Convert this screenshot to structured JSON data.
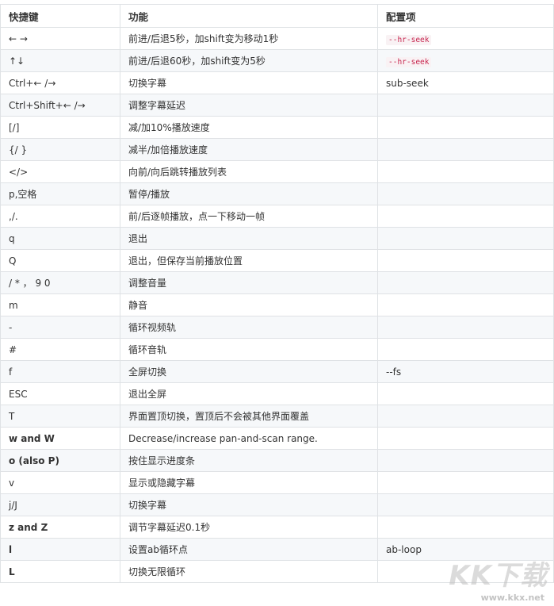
{
  "table": {
    "headers": [
      "快捷键",
      "功能",
      "配置项"
    ],
    "rows": [
      {
        "key": "← →",
        "func": "前进/后退5秒，加shift变为移动1秒",
        "cfg": "--hr-seek",
        "cfg_code": true,
        "bold": false
      },
      {
        "key": "↑↓",
        "func": "前进/后退60秒，加shift变为5秒",
        "cfg": "--hr-seek",
        "cfg_code": true,
        "bold": false
      },
      {
        "key": "Ctrl+← /→",
        "func": "切换字幕",
        "cfg": "sub-seek",
        "cfg_code": false,
        "bold": false
      },
      {
        "key": "Ctrl+Shift+← /→",
        "func": "调整字幕延迟",
        "cfg": "",
        "cfg_code": false,
        "bold": false
      },
      {
        "key": "[/]",
        "func": "减/加10%播放速度",
        "cfg": "",
        "cfg_code": false,
        "bold": false
      },
      {
        "key": "{/ }",
        "func": "减半/加倍播放速度",
        "cfg": "",
        "cfg_code": false,
        "bold": false
      },
      {
        "key": "</>",
        "func": "向前/向后跳转播放列表",
        "cfg": "",
        "cfg_code": false,
        "bold": false
      },
      {
        "key": "p,空格",
        "func": "暂停/播放",
        "cfg": "",
        "cfg_code": false,
        "bold": false
      },
      {
        "key": ",/.",
        "func": "前/后逐帧播放，点一下移动一帧",
        "cfg": "",
        "cfg_code": false,
        "bold": false
      },
      {
        "key": "q",
        "func": "退出",
        "cfg": "",
        "cfg_code": false,
        "bold": false
      },
      {
        "key": "Q",
        "func": "退出，但保存当前播放位置",
        "cfg": "",
        "cfg_code": false,
        "bold": false
      },
      {
        "key": "/ * ， 9 0",
        "func": "调整音量",
        "cfg": "",
        "cfg_code": false,
        "bold": false
      },
      {
        "key": "m",
        "func": "静音",
        "cfg": "",
        "cfg_code": false,
        "bold": false
      },
      {
        "key": "-",
        "func": "循环视频轨",
        "cfg": "",
        "cfg_code": false,
        "bold": false
      },
      {
        "key": "#",
        "func": "循环音轨",
        "cfg": "",
        "cfg_code": false,
        "bold": false
      },
      {
        "key": "f",
        "func": "全屏切换",
        "cfg": "--fs",
        "cfg_code": false,
        "bold": false
      },
      {
        "key": "ESC",
        "func": "退出全屏",
        "cfg": "",
        "cfg_code": false,
        "bold": false
      },
      {
        "key": "T",
        "func": "界面置顶切换，置顶后不会被其他界面覆盖",
        "cfg": "",
        "cfg_code": false,
        "bold": false
      },
      {
        "key": "w and W",
        "func": "Decrease/increase pan-and-scan range.",
        "cfg": "",
        "cfg_code": false,
        "bold": true
      },
      {
        "key": "o (also P)",
        "func": "按住显示进度条",
        "cfg": "",
        "cfg_code": false,
        "bold": true
      },
      {
        "key": "v",
        "func": "显示或隐藏字幕",
        "cfg": "",
        "cfg_code": false,
        "bold": false
      },
      {
        "key": "j/J",
        "func": "切换字幕",
        "cfg": "",
        "cfg_code": false,
        "bold": false
      },
      {
        "key": "z and Z",
        "func": "调节字幕延迟0.1秒",
        "cfg": "",
        "cfg_code": false,
        "bold": true
      },
      {
        "key": "l",
        "func": "设置ab循环点",
        "cfg": "ab-loop",
        "cfg_code": false,
        "bold": true
      },
      {
        "key": "L",
        "func": "切换无限循环",
        "cfg": "",
        "cfg_code": false,
        "bold": true
      }
    ]
  },
  "watermark": {
    "logo": "KK下载",
    "url": "www.kkx.net"
  }
}
